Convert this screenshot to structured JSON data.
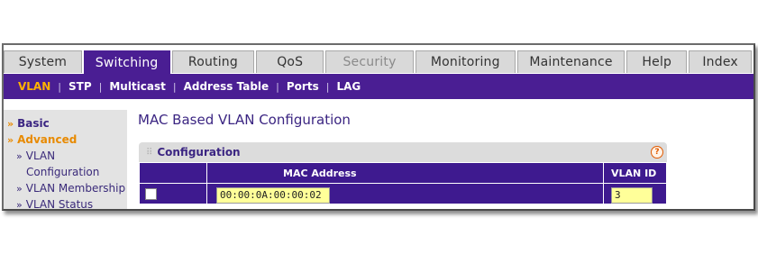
{
  "tabs": [
    "System",
    "Switching",
    "Routing",
    "QoS",
    "Security",
    "Monitoring",
    "Maintenance",
    "Help",
    "Index"
  ],
  "subnav": [
    "VLAN",
    "STP",
    "Multicast",
    "Address Table",
    "Ports",
    "LAG"
  ],
  "sidebar": {
    "basic": "Basic",
    "advanced": "Advanced",
    "vlan_config_1": "VLAN",
    "vlan_config_2": "Configuration",
    "vlan_membership": "VLAN Membership",
    "vlan_status": "VLAN Status"
  },
  "page_title": "MAC Based VLAN Configuration",
  "panel": {
    "title": "Configuration"
  },
  "table": {
    "col_mac": "MAC Address",
    "col_vlan": "VLAN ID",
    "row": {
      "mac": "00:00:0A:00:00:02",
      "vlan": "3"
    }
  },
  "colors": {
    "brand_purple": "#4a1e93",
    "active_orange": "#ffb300",
    "field_yellow": "#ffff99"
  }
}
